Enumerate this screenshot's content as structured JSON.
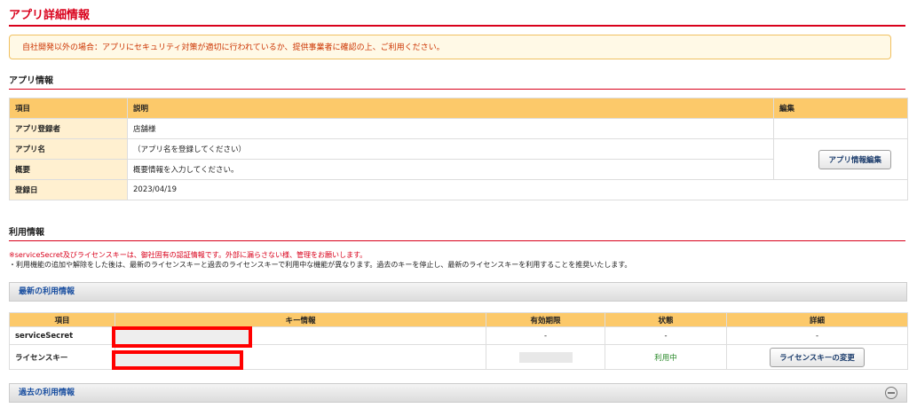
{
  "page": {
    "title": "アプリ詳細情報",
    "notice": "自社開発以外の場合：アプリにセキュリティ対策が適切に行われているか、提供事業者に確認の上、ご利用ください。"
  },
  "app_info": {
    "section_title": "アプリ情報",
    "headers": {
      "item": "項目",
      "description": "説明",
      "edit": "編集"
    },
    "rows": [
      {
        "label": "アプリ登録者",
        "value": "店舗様"
      },
      {
        "label": "アプリ名",
        "value": "（アプリ名を登録してください）"
      },
      {
        "label": "概要",
        "value": "概要情報を入力してください。"
      },
      {
        "label": "登録日",
        "value": "2023/04/19"
      }
    ],
    "edit_button": "アプリ情報編集"
  },
  "usage_info": {
    "section_title": "利用情報",
    "warning": "※serviceSecret及びライセンスキーは、御社固有の認証情報です。外部に漏らさない様、管理をお願いします。",
    "note": "・利用機能の追加や解除をした後は、最新のライセンスキーと過去のライセンスキーで利用中な機能が異なります。過去のキーを停止し、最新のライセンスキーを利用することを推奨いたします。",
    "latest_bar": "最新の利用情報",
    "past_bar": "過去の利用情報",
    "headers": {
      "item": "項目",
      "key": "キー情報",
      "expiry": "有効期限",
      "status": "状態",
      "detail": "詳細"
    },
    "rows": [
      {
        "item": "serviceSecret",
        "expiry": "-",
        "status": "-",
        "detail": "-"
      },
      {
        "item": "ライセンスキー",
        "status": "利用中"
      }
    ],
    "change_key_button": "ライセンスキーの変更"
  },
  "colors": {
    "accent": "#d9001b",
    "header_bg": "#fcc96a",
    "label_bg": "#fff0d0",
    "link": "#1a4fa0"
  }
}
